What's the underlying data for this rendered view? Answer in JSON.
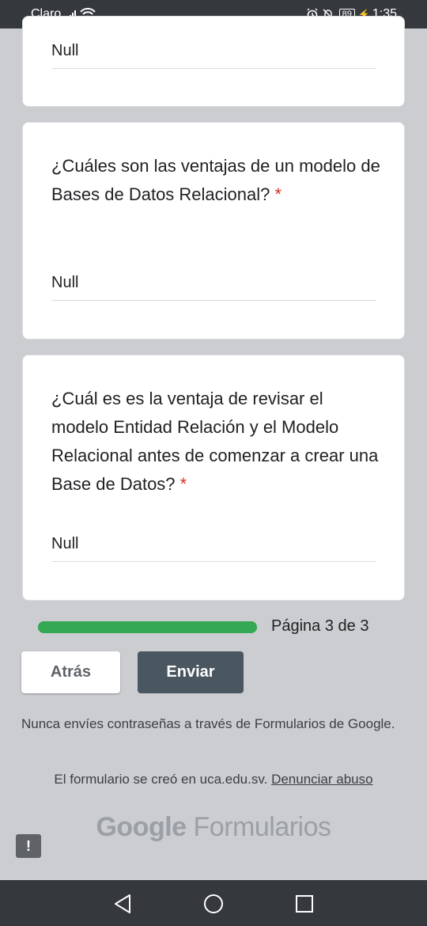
{
  "status_bar": {
    "carrier": "Claro",
    "battery": "89",
    "time": "1:35"
  },
  "cards": [
    {
      "question": "",
      "required_mark": "",
      "answer": "Null"
    },
    {
      "question": "¿Cuáles son las ventajas de un modelo de Bases de Datos Relacional?",
      "required_mark": "*",
      "answer": "Null"
    },
    {
      "question": "¿Cuál es es la ventaja de revisar el modelo Entidad Relación y el Modelo Relacional antes de comenzar a crear una Base de Datos?",
      "required_mark": "*",
      "answer": "Null"
    }
  ],
  "progress": {
    "label": "Página 3 de 3",
    "fraction": 1.0,
    "color": "#34a853"
  },
  "buttons": {
    "back": "Atrás",
    "submit": "Enviar"
  },
  "footer": {
    "warning": "Nunca envíes contraseñas a través de Formularios de Google.",
    "created_text": "El formulario se creó en uca.edu.sv.",
    "abuse_link": "Denunciar abuso",
    "brand_google": "Google",
    "brand_forms": "Formularios",
    "feedback_icon": "!"
  },
  "nav": {
    "back_icon": "back-triangle",
    "home_icon": "home-circle",
    "recents_icon": "recents-square"
  }
}
